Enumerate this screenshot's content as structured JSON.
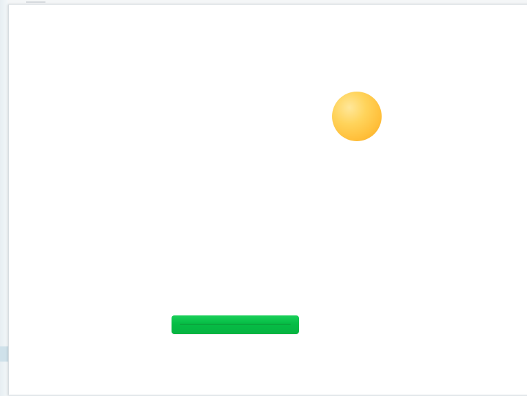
{
  "game": {
    "objects": {
      "ball": {
        "icon": "ball-icon",
        "color": "#ffbf3a"
      },
      "paddle": {
        "icon": "paddle-icon",
        "color": "#06bd45"
      }
    }
  },
  "colors": {
    "background": "#ffffff",
    "ball": "#ffbf3a",
    "paddle": "#06bd45",
    "window_edge": "#d7dde1"
  }
}
